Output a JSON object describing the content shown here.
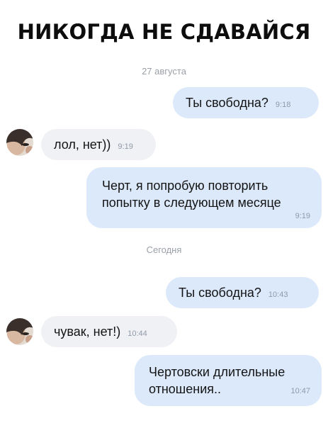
{
  "headline": "НИКОГДА НЕ СДАВАЙСЯ",
  "chat": {
    "date_1": "27 августа",
    "date_2": "Сегодня",
    "messages": [
      {
        "direction": "out",
        "text": "Ты свободна?",
        "time": "9:18"
      },
      {
        "direction": "in",
        "text": "лол, нет))",
        "time": "9:19"
      },
      {
        "direction": "out",
        "line_1": "Черт, я попробую повторить",
        "line_2": "попытку в следующем месяце",
        "time": "9:19"
      },
      {
        "direction": "out",
        "text": "Ты свободна?",
        "time": "10:43"
      },
      {
        "direction": "in",
        "text": "чувак, нет!)",
        "time": "10:44"
      },
      {
        "direction": "out",
        "line_1": "Чертовски длительные",
        "line_2": "отношения..",
        "time": "10:47"
      }
    ]
  },
  "colors": {
    "outgoing_bubble": "#dce9fb",
    "incoming_bubble": "#f0f1f4",
    "timestamp": "#8f9aa8"
  },
  "icons": {
    "avatar": "user-avatar-photo"
  }
}
